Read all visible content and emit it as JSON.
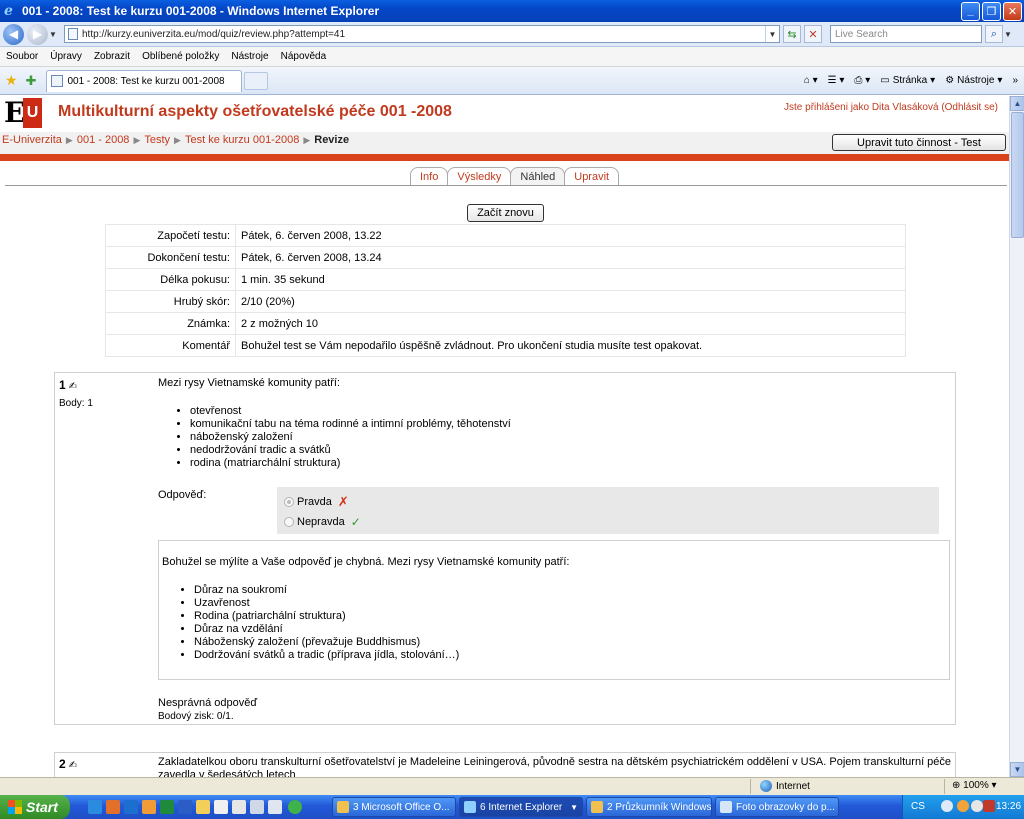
{
  "window": {
    "title": "001 - 2008: Test ke kurzu 001-2008 - Windows Internet Explorer",
    "url": "http://kurzy.euniverzita.eu/mod/quiz/review.php?attempt=41",
    "search_placeholder": "Live Search"
  },
  "menu": [
    "Soubor",
    "Úpravy",
    "Zobrazit",
    "Oblíbené položky",
    "Nástroje",
    "Nápověda"
  ],
  "tab": {
    "label": "001 - 2008: Test ke kurzu 001-2008"
  },
  "toolbar": {
    "page_label": "Stránka",
    "tools_label": "Nástroje"
  },
  "site": {
    "logo_e": "E",
    "logo_u": "U",
    "course_title": "Multikulturní aspekty ošetřovatelské péče 001 -2008",
    "login_info": "Jste přihlášeni jako Dita Vlasáková (Odhlásit se)",
    "breadcrumb": [
      "E-Univerzita",
      "001 - 2008",
      "Testy",
      "Test ke kurzu 001-2008"
    ],
    "breadcrumb_current": "Revize",
    "edit_button": "Upravit tuto činnost - Test"
  },
  "quiz_tabs": [
    {
      "label": "Info",
      "active": false
    },
    {
      "label": "Výsledky",
      "active": false
    },
    {
      "label": "Náhled",
      "active": true
    },
    {
      "label": "Upravit",
      "active": false
    }
  ],
  "restart_label": "Začít znovu",
  "summary": [
    {
      "key": "Započetí testu:",
      "value": "Pátek, 6. červen 2008, 13.22"
    },
    {
      "key": "Dokončení testu:",
      "value": "Pátek, 6. červen 2008, 13.24"
    },
    {
      "key": "Délka pokusu:",
      "value": "1 min. 35 sekund"
    },
    {
      "key": "Hrubý skór:",
      "value": "2/10 (20%)"
    },
    {
      "key": "Známka:",
      "value": "2 z možných 10"
    },
    {
      "key": "Komentář",
      "value": "Bohužel test se Vám nepodařilo úspěšně zvládnout. Pro ukončení studia musíte test opakovat."
    }
  ],
  "question1": {
    "number": "1",
    "points": "Body: 1",
    "text": "Mezi rysy Vietnamské komunity patří:",
    "items": [
      "otevřenost",
      "komunikační tabu na téma rodinné a intimní problémy, těhotenství",
      "náboženský založení",
      "nedodržování tradic a svátků",
      "rodina (matriarchální struktura)"
    ],
    "answer_label": "Odpověď:",
    "options": [
      {
        "label": "Pravda",
        "selected": true,
        "mark": "✗"
      },
      {
        "label": "Nepravda",
        "selected": false,
        "mark": "✓"
      }
    ],
    "feedback_text": "Bohužel se mýlíte a Vaše odpověď je chybná. Mezi rysy Vietnamské komunity patří:",
    "feedback_items": [
      "Důraz na soukromí",
      "Uzavřenost",
      "Rodina (patriarchální struktura)",
      "Důraz na vzdělání",
      "Náboženský založení (převažuje Buddhismus)",
      "Dodržování svátků a tradic (příprava jídla, stolování…)"
    ],
    "result": "Nesprávná odpověď",
    "score": "Bodový zisk: 0/1."
  },
  "question2": {
    "number": "2",
    "text": "Zakladatelkou oboru transkulturní ošetřovatelství je Madeleine Leiningerová, původně sestra na dětském psychiatrickém oddělení v USA. Pojem transkulturní péče zavedla v šedesátých letech"
  },
  "status": {
    "zone": "Internet",
    "zoom": "100%"
  },
  "taskbar": {
    "start": "Start",
    "items": [
      {
        "label": "3 Microsoft Office O...",
        "active": false
      },
      {
        "label": "6 Internet Explorer",
        "active": true
      },
      {
        "label": "2 Průzkumník Windows",
        "active": false
      },
      {
        "label": "Foto obrazovky do p...",
        "active": false
      }
    ],
    "lang": "CS",
    "clock": "13:26"
  },
  "colors": {
    "accent": "#c23a1e",
    "redbar": "#d9421a",
    "taskbar": "#2258d8"
  }
}
